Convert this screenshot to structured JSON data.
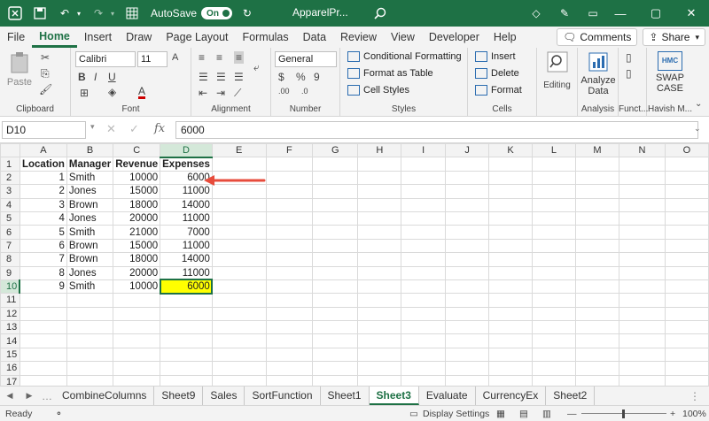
{
  "titlebar": {
    "autosave_label": "AutoSave",
    "autosave_state": "On",
    "filename": "ApparelPr..."
  },
  "menu": {
    "tabs": [
      "File",
      "Home",
      "Insert",
      "Draw",
      "Page Layout",
      "Formulas",
      "Data",
      "Review",
      "View",
      "Developer",
      "Help"
    ],
    "active": "Home",
    "comments": "Comments",
    "share": "Share"
  },
  "ribbon": {
    "clipboard": {
      "paste": "Paste",
      "label": "Clipboard"
    },
    "font": {
      "name": "Calibri",
      "size": "11",
      "label": "Font"
    },
    "alignment": {
      "label": "Alignment"
    },
    "number": {
      "format": "General",
      "label": "Number"
    },
    "styles": {
      "conditional": "Conditional Formatting",
      "table": "Format as Table",
      "cell": "Cell Styles",
      "label": "Styles"
    },
    "cells": {
      "insert": "Insert",
      "delete": "Delete",
      "format": "Format",
      "label": "Cells"
    },
    "editing": {
      "label": "Editing"
    },
    "analysis": {
      "analyze": "Analyze Data",
      "label": "Analysis"
    },
    "functions": {
      "label": "Funct..."
    },
    "addin": {
      "logo": "HMC",
      "swap": "SWAP CASE",
      "label": "Havish M..."
    }
  },
  "formula_bar": {
    "cell": "D10",
    "value": "6000"
  },
  "grid": {
    "columns": [
      "A",
      "B",
      "C",
      "D",
      "E",
      "F",
      "G",
      "H",
      "I",
      "J",
      "K",
      "L",
      "M",
      "N",
      "O"
    ],
    "rows": [
      [
        "Location",
        "Manager",
        "Revenue",
        "Expenses"
      ],
      [
        "1",
        "Smith",
        "10000",
        "6000"
      ],
      [
        "2",
        "Jones",
        "15000",
        "11000"
      ],
      [
        "3",
        "Brown",
        "18000",
        "14000"
      ],
      [
        "4",
        "Jones",
        "20000",
        "11000"
      ],
      [
        "5",
        "Smith",
        "21000",
        "7000"
      ],
      [
        "6",
        "Brown",
        "15000",
        "11000"
      ],
      [
        "7",
        "Brown",
        "18000",
        "14000"
      ],
      [
        "8",
        "Jones",
        "20000",
        "11000"
      ],
      [
        "9",
        "Smith",
        "10000",
        "6000"
      ]
    ],
    "row_count": 17
  },
  "sheet_tabs": [
    "CombineColumns",
    "Sheet9",
    "Sales",
    "SortFunction",
    "Sheet1",
    "Sheet3",
    "Evaluate",
    "CurrencyEx",
    "Sheet2"
  ],
  "active_sheet": "Sheet3",
  "status": {
    "ready": "Ready",
    "display_settings": "Display Settings",
    "zoom": "100%"
  },
  "colors": {
    "accent": "#1e7145",
    "highlight": "#ffff00",
    "arrow": "#e74c3c"
  }
}
